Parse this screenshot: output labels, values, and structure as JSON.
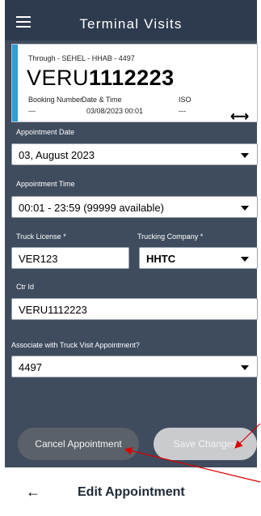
{
  "header": {
    "title": "Terminal Visits",
    "menu_icon": "hamburger-menu-icon"
  },
  "card": {
    "through": "Through - SEHEL - HHAB - 4497",
    "container_prefix": "VERU",
    "container_number": "1112223",
    "booking_label": "Booking Number",
    "date_label": "Date & Time",
    "iso_label": "ISO",
    "booking_value": "---",
    "date_value": "03/08/2023 00:01",
    "iso_value": "---",
    "swap_icon": "left-right-arrow-icon",
    "accent_color": "#2f9fd8"
  },
  "form": {
    "appointment_date_label": "Appointment Date",
    "appointment_date_value": "03, August 2023",
    "appointment_time_label": "Appointment Time",
    "appointment_time_value": "00:01 - 23:59 (99999 available)",
    "truck_license_label": "Truck License *",
    "truck_license_value": "VER123",
    "trucking_company_label": "Trucking Company *",
    "trucking_company_value": "HHTC",
    "ctr_id_label": "Ctr Id",
    "ctr_id_value": "VERU1112223",
    "associate_label": "Associate with Truck Visit Appointment?",
    "associate_value": "4497"
  },
  "actions": {
    "cancel_label": "Cancel Appointment",
    "save_label": "Save Changes"
  },
  "footer": {
    "title": "Edit Appointment",
    "back_icon": "back-arrow-icon"
  },
  "colors": {
    "header_bg": "#2e3b4e",
    "body_bg": "#3f4c5e",
    "annotation_red": "#d90000"
  }
}
